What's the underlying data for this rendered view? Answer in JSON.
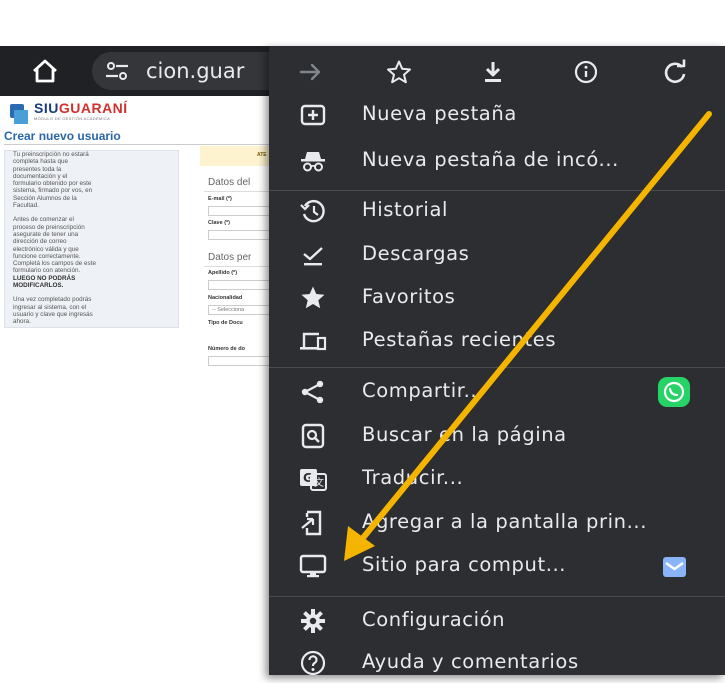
{
  "browser": {
    "url_text": "cion.guar"
  },
  "page": {
    "logo_part1": "SIU",
    "logo_part2": "GUARANÍ",
    "logo_subtitle": "MÓDULO DE GESTIÓN ACADÉMICA",
    "form_title": "Crear nuevo usuario",
    "info_lines": [
      "Tu preinscripción no estará",
      "completa hasta que",
      "presentes toda la",
      "documentación y el",
      "formulario obtenido por este",
      "sistema, firmado por vos, en",
      "Sección Alumnos de la",
      "Facultad."
    ],
    "info_lines_2": [
      "Antes de comenzar el",
      "proceso de preinscripción",
      "asegurate de tener una",
      "dirección de correo",
      "electrónico válida y que",
      "funcione correctamente.",
      "Completá los campos de este",
      "formulario con atención."
    ],
    "info_warning_lines": [
      "LUEGO NO PODRÁS",
      "MODIFICARLOS."
    ],
    "info_lines_3": [
      "Una vez completado podrás",
      "ingresar al sistema, con el",
      "usuario y clave que ingresás",
      "ahora."
    ],
    "warning_banner": "ATE",
    "section_1": "Datos del",
    "email_label": "E-mail (*)",
    "clave_label": "Clave (*)",
    "section_2": "Datos per",
    "apellido_label": "Apellido (*)",
    "nacionalidad_label": "Nacionalidad",
    "select_placeholder": "-- Selecciona",
    "tipo_doc_label": "Tipo de Docu",
    "numero_doc_label": "Número de do"
  },
  "menu": {
    "toolbar_icons": [
      "forward-icon",
      "bookmark-star-icon",
      "download-icon",
      "info-icon",
      "reload-icon"
    ],
    "items": [
      {
        "label": "Nueva pestaña",
        "icon": "new-tab-icon"
      },
      {
        "label": "Nueva pestaña de incó...",
        "icon": "incognito-icon"
      },
      {
        "label": "Historial",
        "icon": "history-icon"
      },
      {
        "label": "Descargas",
        "icon": "downloads-icon"
      },
      {
        "label": "Favoritos",
        "icon": "star-icon"
      },
      {
        "label": "Pestañas recientes",
        "icon": "recent-tabs-icon"
      },
      {
        "label": "Compartir...",
        "icon": "share-icon"
      },
      {
        "label": "Buscar en la página",
        "icon": "find-in-page-icon"
      },
      {
        "label": "Traducir...",
        "icon": "translate-icon"
      },
      {
        "label": "Agregar a la pantalla prin...",
        "icon": "add-to-home-icon"
      },
      {
        "label": "Sitio para comput...",
        "icon": "desktop-icon"
      },
      {
        "label": "Configuración",
        "icon": "settings-gear-icon"
      },
      {
        "label": "Ayuda y comentarios",
        "icon": "help-icon"
      }
    ]
  },
  "colors": {
    "menu_bg": "#2d2e31",
    "text": "#e8eaed",
    "whatsapp": "#25d366",
    "checkbox_accent": "#8ab4f8",
    "annotation_arrow": "#f5b400"
  }
}
